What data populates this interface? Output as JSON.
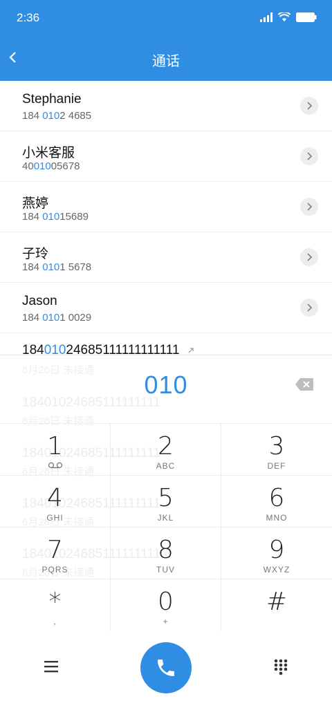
{
  "status": {
    "time": "2:36"
  },
  "header": {
    "title": "通话"
  },
  "contacts": [
    {
      "name": "Stephanie",
      "num_pre": "184 ",
      "num_hl": "010",
      "num_post": "2 4685"
    },
    {
      "name": "小米客服",
      "num_pre": "40",
      "num_hl": "010",
      "num_post": "05678"
    },
    {
      "name": "燕婷",
      "num_pre": "184 ",
      "num_hl": "010",
      "num_post": "15689"
    },
    {
      "name": "子玲",
      "num_pre": "184 ",
      "num_hl": "010",
      "num_post": "1 5678"
    },
    {
      "name": "Jason",
      "num_pre": "184 ",
      "num_hl": "010",
      "num_post": "1 0029"
    }
  ],
  "recent_partial": {
    "pre": "184",
    "hl": "010",
    "post": "24685111111111111"
  },
  "ghost_rows": [
    {
      "number": "18401024685111111111",
      "sub": "6月26日 未接通"
    },
    {
      "number": "18401024685111111111",
      "sub": "6月26日 未接通"
    },
    {
      "number": "18401024685111111111",
      "sub": "6月26日 未接通"
    },
    {
      "number": "18401024685111111111",
      "sub": "6月26日 未接通"
    },
    {
      "number": "18401024685111111111",
      "sub": "6月26日 未接通"
    }
  ],
  "dialpad": {
    "entered": "010",
    "keys": [
      {
        "digit": "1",
        "letters": ""
      },
      {
        "digit": "2",
        "letters": "ABC"
      },
      {
        "digit": "3",
        "letters": "DEF"
      },
      {
        "digit": "4",
        "letters": "GHI"
      },
      {
        "digit": "5",
        "letters": "JKL"
      },
      {
        "digit": "6",
        "letters": "MNO"
      },
      {
        "digit": "7",
        "letters": "PQRS"
      },
      {
        "digit": "8",
        "letters": "TUV"
      },
      {
        "digit": "9",
        "letters": "WXYZ"
      },
      {
        "digit": "*",
        "letters": ","
      },
      {
        "digit": "0",
        "letters": "+"
      },
      {
        "digit": "#",
        "letters": ""
      }
    ]
  },
  "colors": {
    "accent": "#2f8ee3"
  },
  "icons": {
    "back": "chevron-left-icon",
    "detail": "chevron-right-icon",
    "delete": "backspace-icon",
    "voicemail": "voicemail-icon",
    "menu": "menu-icon",
    "call": "phone-icon",
    "keypad": "keypad-icon",
    "link": "outgoing-arrow-icon"
  }
}
